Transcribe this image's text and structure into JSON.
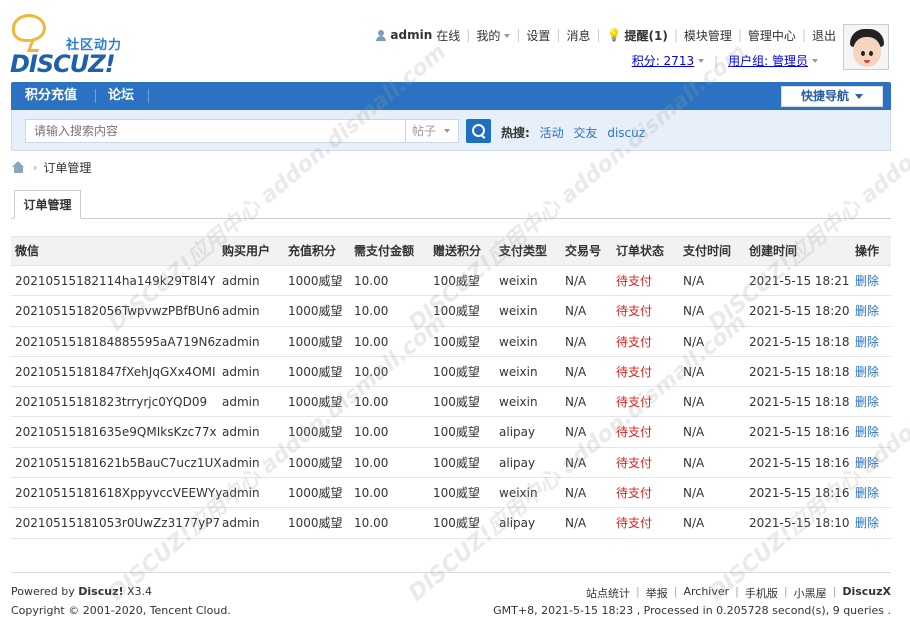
{
  "logo": {
    "sub": "社区动力",
    "main": "DISCUZ!"
  },
  "topnav": {
    "username": "admin",
    "online": "在线",
    "my": "我的",
    "settings": "设置",
    "messages": "消息",
    "remind": "提醒(1)",
    "module_manage": "模块管理",
    "admin_center": "管理中心",
    "logout": "退出"
  },
  "subnav": {
    "credits": "积分: 2713",
    "usergroup": "用户组: 管理员"
  },
  "mainnav": {
    "items": [
      "积分充值",
      "论坛"
    ],
    "quicknav": "快捷导航"
  },
  "search": {
    "placeholder": "请输入搜索内容",
    "type": "帖子",
    "hot_label": "热搜:",
    "hot_links": [
      "活动",
      "交友",
      "discuz"
    ]
  },
  "breadcrumb": {
    "current": "订单管理"
  },
  "tab": {
    "label": "订单管理"
  },
  "table": {
    "headers": [
      "微信",
      "购买用户",
      "充值积分",
      "需支付金额",
      "赠送积分",
      "支付类型",
      "交易号",
      "订单状态",
      "支付时间",
      "创建时间",
      "操作"
    ],
    "rows": [
      [
        "20210515182114ha149k29T8l4Y",
        "admin",
        "1000威望",
        "10.00",
        "100威望",
        "weixin",
        "N/A",
        "待支付",
        "N/A",
        "2021-5-15 18:21",
        "删除"
      ],
      [
        "20210515182056TwpvwzPBfBUn6",
        "admin",
        "1000威望",
        "10.00",
        "100威望",
        "weixin",
        "N/A",
        "待支付",
        "N/A",
        "2021-5-15 18:20",
        "删除"
      ],
      [
        "2021051518184885595aA719N6z",
        "admin",
        "1000威望",
        "10.00",
        "100威望",
        "weixin",
        "N/A",
        "待支付",
        "N/A",
        "2021-5-15 18:18",
        "删除"
      ],
      [
        "20210515181847fXehJqGXx4OMI",
        "admin",
        "1000威望",
        "10.00",
        "100威望",
        "weixin",
        "N/A",
        "待支付",
        "N/A",
        "2021-5-15 18:18",
        "删除"
      ],
      [
        "20210515181823trryrjc0YQD09",
        "admin",
        "1000威望",
        "10.00",
        "100威望",
        "weixin",
        "N/A",
        "待支付",
        "N/A",
        "2021-5-15 18:18",
        "删除"
      ],
      [
        "20210515181635e9QMIksKzc77x",
        "admin",
        "1000威望",
        "10.00",
        "100威望",
        "alipay",
        "N/A",
        "待支付",
        "N/A",
        "2021-5-15 18:16",
        "删除"
      ],
      [
        "20210515181621b5BauC7ucz1UX",
        "admin",
        "1000威望",
        "10.00",
        "100威望",
        "alipay",
        "N/A",
        "待支付",
        "N/A",
        "2021-5-15 18:16",
        "删除"
      ],
      [
        "20210515181618XppyvccVEEWYy",
        "admin",
        "1000威望",
        "10.00",
        "100威望",
        "weixin",
        "N/A",
        "待支付",
        "N/A",
        "2021-5-15 18:16",
        "删除"
      ],
      [
        "20210515181053r0UwZz3177yP7",
        "admin",
        "1000威望",
        "10.00",
        "100威望",
        "alipay",
        "N/A",
        "待支付",
        "N/A",
        "2021-5-15 18:10",
        "删除"
      ]
    ]
  },
  "footer": {
    "powered_prefix": "Powered by",
    "powered_brand": "Discuz!",
    "powered_version": "X3.4",
    "copyright": "Copyright © 2001-2020, Tencent Cloud.",
    "links": [
      "站点统计",
      "举报",
      "Archiver",
      "手机版",
      "小黑屋"
    ],
    "brand": "DiscuzX",
    "stats": "GMT+8, 2021-5-15 18:23 , Processed in 0.205728 second(s), 9 queries ."
  },
  "watermark": "DISCUZ!应用中心 addon.dismall.com",
  "colors": {
    "nav_blue": "#2b73c2",
    "status_red": "#e0211d",
    "link_blue": "#2b73c2",
    "search_bg": "#e7f0fa"
  }
}
